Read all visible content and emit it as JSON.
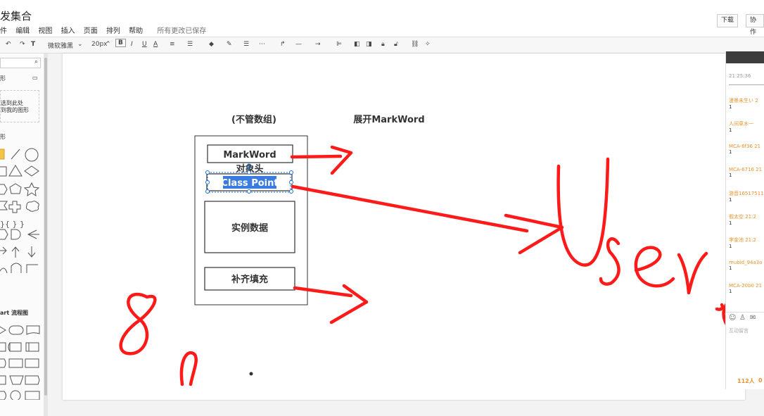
{
  "window": {
    "title": "发集合",
    "menus": [
      "件",
      "编辑",
      "视图",
      "插入",
      "页面",
      "排列",
      "帮助"
    ],
    "save_status": "所有更改已保存",
    "download_label": "下载",
    "collab_label": "协作"
  },
  "toolbar": {
    "font_name": "微软雅黑",
    "font_size": "20px",
    "bold": "B",
    "italic": "I",
    "underline": "U",
    "font_color": "A"
  },
  "sidebar": {
    "search_icon": "search-icon",
    "section_shapes_label": "形",
    "dropzone_line1": "选到此处",
    "dropzone_line2": "到我的图形",
    "section_basic_label": "形",
    "section_flowchart_label": "art 流程图",
    "brace_glyphs": "}{ } }"
  },
  "diagram": {
    "header_left": "(不管数组)",
    "header_right": "展开MarkWord",
    "markword_label": "MarkWord",
    "object_header_label": "对象头",
    "class_point_label": "Class Point",
    "instance_data_label": "实例数据",
    "padding_label": "补齐填充",
    "accent_color": "#ff1a1a",
    "selection_color": "#1e6ed8"
  },
  "chat": {
    "top_time": "21:25:36",
    "messages": [
      {
        "user": "漫景未生い 2",
        "text": "1"
      },
      {
        "user": "人间草木一",
        "text": "1"
      },
      {
        "user": "MCA-6f36 21",
        "text": "1"
      },
      {
        "user": "MCA-6716 21",
        "text": "1"
      },
      {
        "user": "游音16517511",
        "text": "1"
      },
      {
        "user": "假太空 21:2",
        "text": "1"
      },
      {
        "user": "李金池 21:2",
        "text": "1"
      },
      {
        "user": "mubid_94a3o",
        "text": "1"
      },
      {
        "user": "MCA-20b0 21",
        "text": "1"
      }
    ],
    "input_placeholder": "互动留言",
    "audience_count": "112人",
    "extra_count": "0"
  }
}
